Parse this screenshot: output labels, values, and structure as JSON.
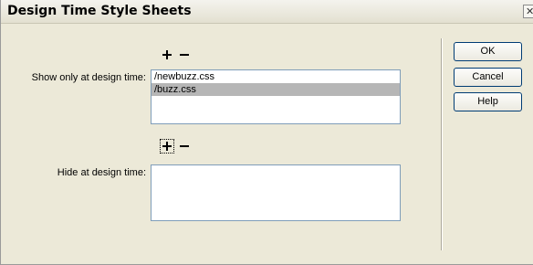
{
  "dialog": {
    "title": "Design Time Style Sheets",
    "close_glyph": "✕"
  },
  "show_section": {
    "label": "Show only at design time:",
    "items": [
      "/newbuzz.css",
      "/buzz.css"
    ],
    "selected_index": 1
  },
  "hide_section": {
    "label": "Hide at design time:",
    "items": []
  },
  "buttons": {
    "ok": "OK",
    "cancel": "Cancel",
    "help": "Help"
  },
  "icons": {
    "add": "plus-icon",
    "remove": "minus-icon"
  },
  "colors": {
    "dialog_bg": "#ece9d8",
    "selection_bg": "#b6b6b6",
    "button_border": "#003c74"
  }
}
